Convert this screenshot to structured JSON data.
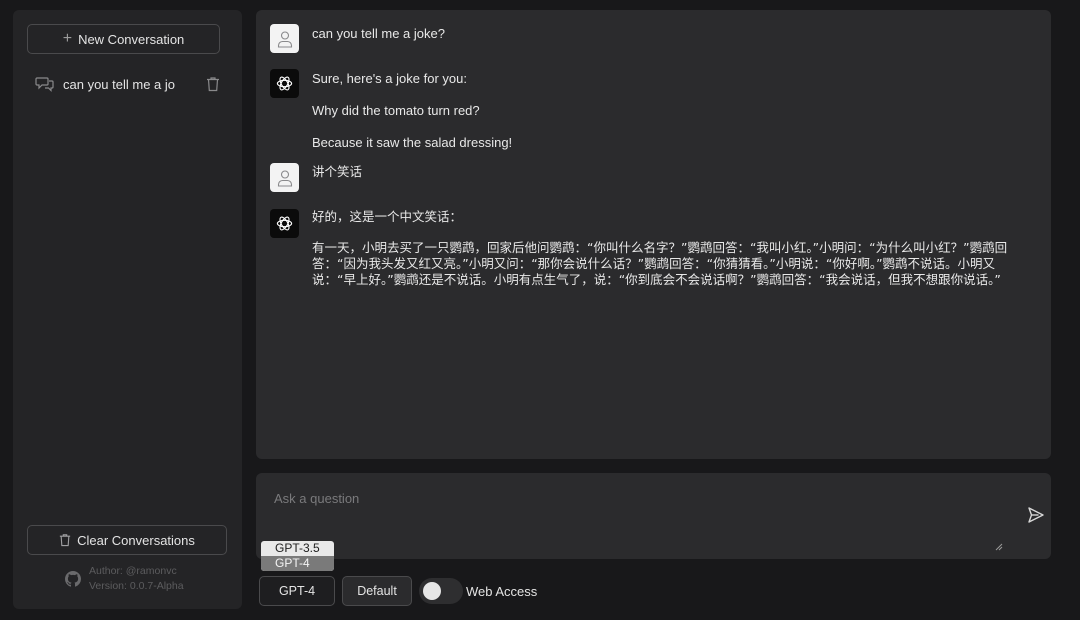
{
  "sidebar": {
    "new_conversation_label": "New Conversation",
    "conversations": [
      {
        "title": "can you tell me a jo"
      }
    ],
    "clear_label": "Clear Conversations",
    "author": "Author: @ramonvc",
    "version": "Version: 0.0.7-Alpha"
  },
  "chat": {
    "m1": {
      "role": "user",
      "text": "can you tell me a joke?"
    },
    "m2": {
      "role": "assistant",
      "p1": "Sure, here's a joke for you:",
      "p2": "Why did the tomato turn red?",
      "p3": "Because it saw the salad dressing!"
    },
    "m3": {
      "role": "user",
      "text": "讲个笑话"
    },
    "m4": {
      "role": "assistant",
      "p1": "好的，这是一个中文笑话：",
      "p2": "有一天，小明去买了一只鹦鹉，回家后他问鹦鹉：“你叫什么名字？”鹦鹉回答：“我叫小红。”小明问：“为什么叫小红？”鹦鹉回答：“因为我头发又红又亮。”小明又问：“那你会说什么话？”鹦鹉回答：“你猜猜看。”小明说：“你好啊。”鹦鹉不说话。小明又说：“早上好。”鹦鹉还是不说话。小明有点生气了，说：“你到底会不会说话啊？”鹦鹉回答：“我会说话，但我不想跟你说话。”"
    }
  },
  "input": {
    "placeholder": "Ask a question"
  },
  "model_select": {
    "options": [
      "GPT-3.5",
      "GPT-4"
    ],
    "selected": "GPT-4"
  },
  "controls": {
    "jailbreak_label": "Default",
    "web_access_label": "Web Access",
    "web_access_enabled": false
  },
  "colors": {
    "background": "#18181a",
    "panel": "#2b2b2d",
    "sidebar": "#242426"
  }
}
